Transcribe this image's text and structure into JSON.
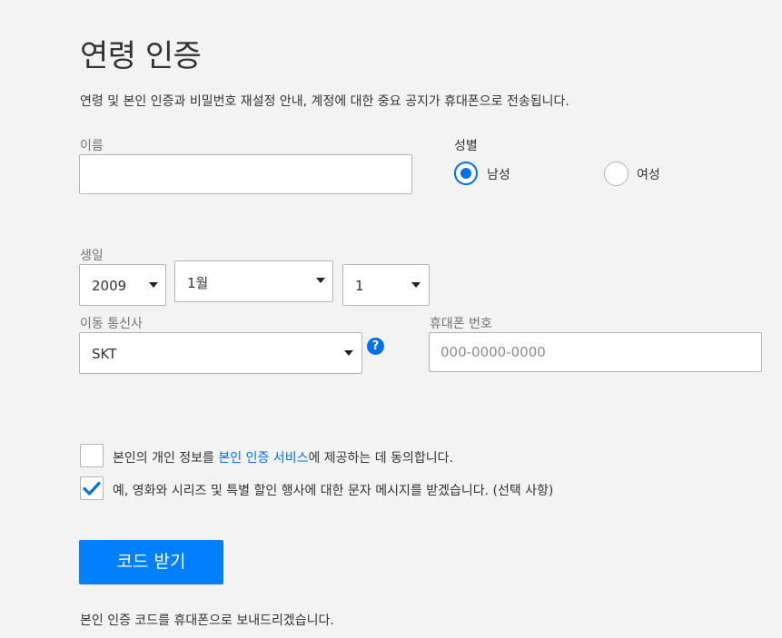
{
  "page": {
    "title": "연령 인증",
    "subtitle": "연령 및 본인 인증과 비밀번호 재설정 안내, 계정에 대한 중요 공지가 휴대폰으로 전송됩니다."
  },
  "name_field": {
    "label": "이름",
    "value": ""
  },
  "gender": {
    "label": "성별",
    "options": [
      {
        "label": "남성",
        "selected": true
      },
      {
        "label": "여성",
        "selected": false
      }
    ]
  },
  "birthdate": {
    "label": "생일",
    "year": "2009",
    "month": "1월",
    "day": "1"
  },
  "carrier": {
    "label": "이동 통신사",
    "value": "SKT",
    "help_glyph": "?"
  },
  "phone": {
    "label": "휴대폰 번호",
    "placeholder": "000-0000-0000",
    "value": ""
  },
  "consents": [
    {
      "checked": false,
      "text_before": "본인의 개인 정보를 ",
      "link_text": "본인 인증 서비스",
      "text_after": "에 제공하는 데 동의합니다."
    },
    {
      "checked": true,
      "text": "예, 영화와 시리즈 및 특별 할인 행사에 대한 문자 메시지를 받겠습니다. (선택 사항)"
    }
  ],
  "submit": {
    "label": "코드 받기"
  },
  "footer_note": "본인 인증 코드를 휴대폰으로 보내드리겠습니다.",
  "colors": {
    "accent": "#0071eb",
    "button": "#0080ff",
    "background": "#f3f3f3"
  }
}
